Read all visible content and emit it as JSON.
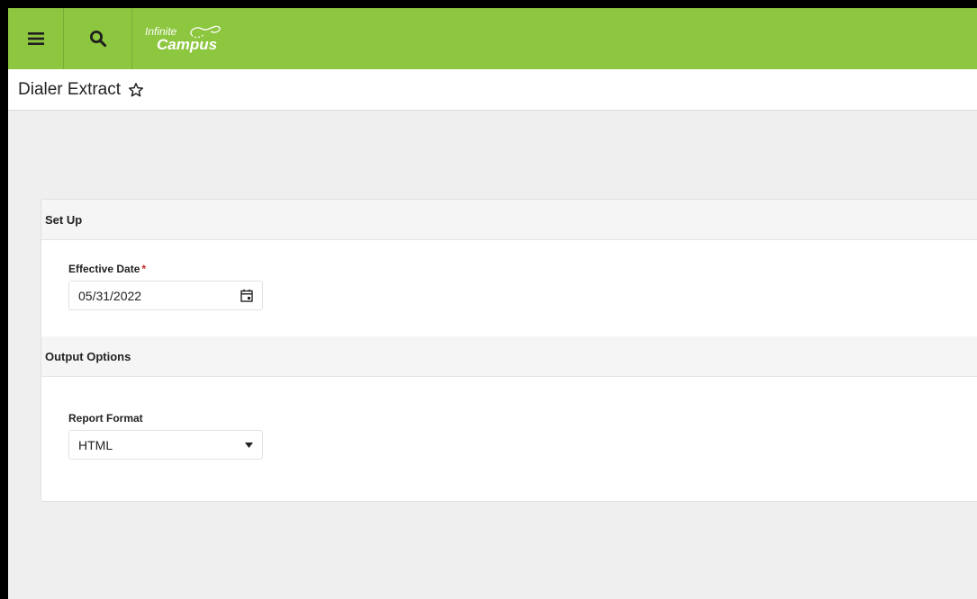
{
  "header": {
    "menu_icon": "hamburger-menu-icon",
    "search_icon": "search-icon",
    "logo_line1": "Infinite",
    "logo_line2": "Campus",
    "brand_color": "#8dc63f"
  },
  "page": {
    "title": "Dialer Extract",
    "favorite_icon": "star-outline-icon"
  },
  "setup": {
    "heading": "Set Up",
    "effective_date_label": "Effective Date",
    "required_marker": "*",
    "effective_date_value": "05/31/2022",
    "calendar_icon": "calendar-icon"
  },
  "output": {
    "heading": "Output Options",
    "report_format_label": "Report Format",
    "report_format_value": "HTML",
    "dropdown_icon": "caret-down-icon"
  }
}
